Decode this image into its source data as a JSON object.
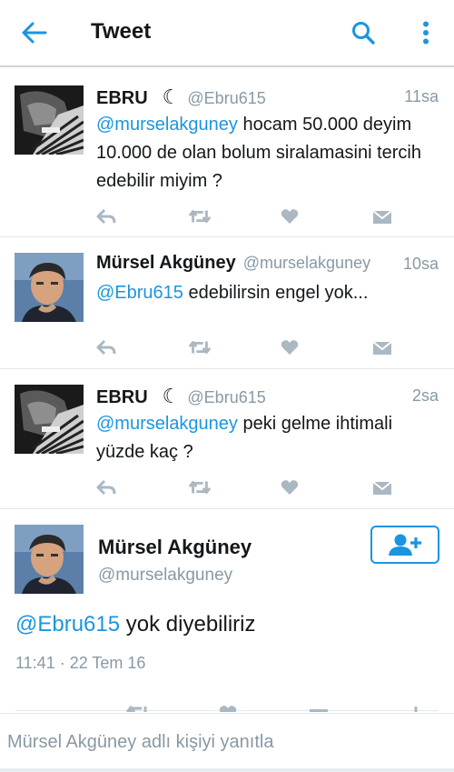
{
  "header": {
    "title": "Tweet"
  },
  "thread": [
    {
      "name": "EBRU",
      "badge": "☾",
      "handle": "@Ebru615",
      "time": "11sa",
      "mention": "@murselakguney",
      "text": " hocam 50.000 deyim  10.000 de olan bolum siralamasini tercih edebilir miyim ?"
    },
    {
      "name": "Mürsel Akgüney",
      "handle": "@murselakguney",
      "time": "10sa",
      "mention": "@Ebru615",
      "text": " edebilirsin engel yok..."
    },
    {
      "name": "EBRU",
      "badge": "☾",
      "handle": "@Ebru615",
      "time": "2sa",
      "mention": "@murselakguney",
      "text": " peki gelme ihtimali yüzde kaç ?"
    }
  ],
  "main_tweet": {
    "name": "Mürsel Akgüney",
    "handle": "@murselakguney",
    "mention": "@Ebru615",
    "text": " yok diyebiliriz",
    "timestamp": "11:41 · 22 Tem 16"
  },
  "reply": {
    "placeholder": "Mürsel Akgüney adlı kişiyi yanıtla"
  },
  "colors": {
    "accent": "#1b95e0",
    "icon_gray": "#aab8c2",
    "secondary_text": "#8899a6"
  }
}
